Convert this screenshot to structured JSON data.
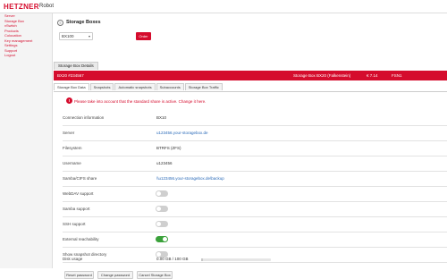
{
  "header": {
    "logo": "HETZNER",
    "subtitle": "Robot"
  },
  "sidebar": {
    "items": [
      {
        "label": "Server"
      },
      {
        "label": "Storage Box"
      },
      {
        "label": "vSwitch"
      },
      {
        "label": "Products"
      },
      {
        "label": "Colocation"
      },
      {
        "label": "Key management"
      },
      {
        "label": "Settings"
      },
      {
        "label": "Support"
      },
      {
        "label": "Logout"
      }
    ]
  },
  "page": {
    "title": "Storage Boxes",
    "title_icon": "storage-icon"
  },
  "order": {
    "select_value": "BX100",
    "button_label": "Order"
  },
  "section": {
    "tab_label": "Storage Box Details"
  },
  "redbar": {
    "id": "BX20 #234567",
    "product": "Storage Box BX20 (Falkenstein)",
    "price": "€ 7.14",
    "location": "FSN1"
  },
  "tabs": [
    {
      "label": "Storage Box Data",
      "active": true
    },
    {
      "label": "Snapshots",
      "active": false
    },
    {
      "label": "Automatic snapshots",
      "active": false
    },
    {
      "label": "Subaccounts",
      "active": false
    },
    {
      "label": "Storage Box Traffic",
      "active": false
    }
  ],
  "info": {
    "icon": "info-icon",
    "text": "Please take into account that the standard share is active. Change it here."
  },
  "rows": [
    {
      "label": "Connection information",
      "value": "BX10",
      "type": "text"
    },
    {
      "label": "Server",
      "value": "u123456.your-storagebox.de",
      "type": "link"
    },
    {
      "label": "Filesystem",
      "value": "BTRFS (ZFS)",
      "type": "text"
    },
    {
      "label": "Username",
      "value": "u123456",
      "type": "text"
    },
    {
      "label": "Samba/CIFS share",
      "value": "\\\\u123456.your-storagebox.de\\backup",
      "type": "link"
    },
    {
      "label": "WebDAV support",
      "type": "toggle",
      "on": false
    },
    {
      "label": "Samba support",
      "type": "toggle",
      "on": false
    },
    {
      "label": "SSH support",
      "type": "toggle",
      "on": false
    },
    {
      "label": "External reachability",
      "type": "toggle",
      "on": true
    },
    {
      "label": "Show snapshot directory",
      "type": "toggle",
      "on": false
    },
    {
      "label": "Disk usage",
      "value": "0.00 GB / 100 GB",
      "type": "usage",
      "usage_fraction": 0.02
    }
  ],
  "buttons": [
    {
      "label": "Reset password"
    },
    {
      "label": "Change password"
    },
    {
      "label": "Cancel Storage Box"
    }
  ],
  "colors": {
    "accent": "#d50c2d",
    "toggle_on": "#3aa13a",
    "link": "#2a6ab8"
  }
}
